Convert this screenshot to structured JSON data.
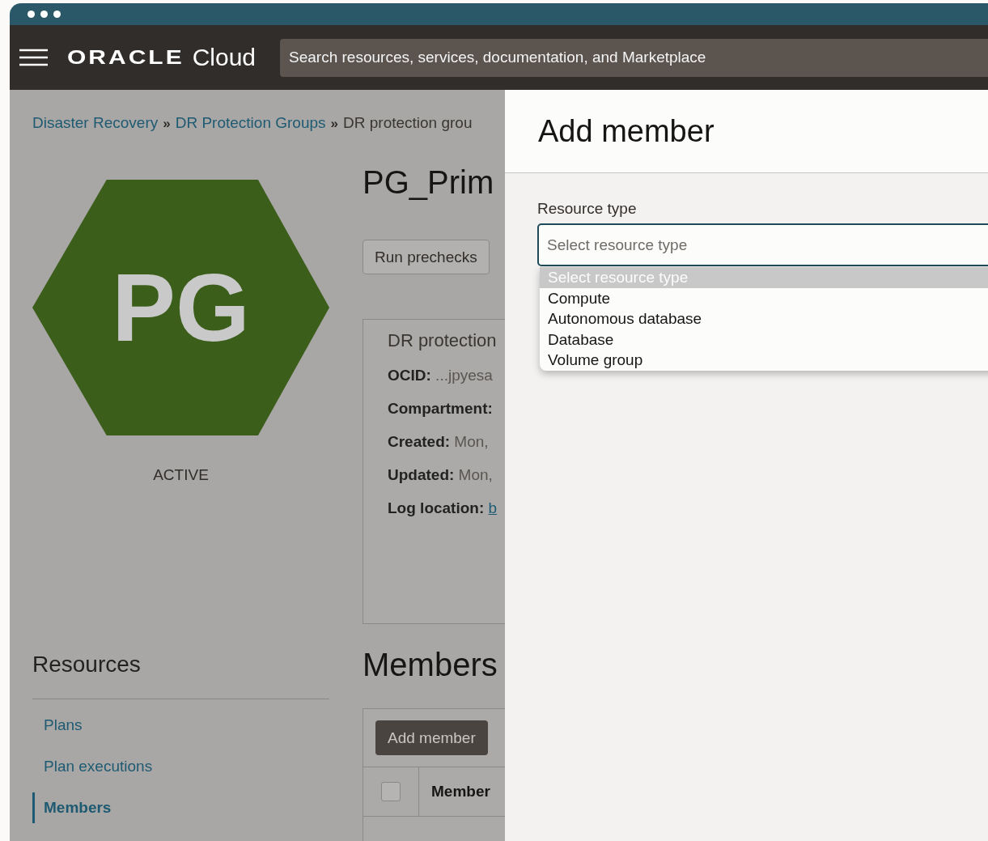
{
  "header": {
    "logo": "ORACLE",
    "product": "Cloud",
    "search": {
      "placeholder": "Search resources, services, documentation, and Marketplace"
    }
  },
  "breadcrumb": [
    {
      "label": "Disaster Recovery",
      "link": true,
      "sep": "»"
    },
    {
      "label": "DR Protection Groups",
      "link": true,
      "sep": "»"
    },
    {
      "label": "DR protection grou",
      "link": false
    }
  ],
  "badge": {
    "initials": "PG",
    "color": "#3b5e1b",
    "status": "ACTIVE"
  },
  "resources": {
    "title": "Resources",
    "items": [
      {
        "label": "Plans",
        "selected": false
      },
      {
        "label": "Plan executions",
        "selected": false
      },
      {
        "label": "Members",
        "selected": true
      }
    ]
  },
  "detail": {
    "title": "PG_Prim",
    "actions": [
      "Run prechecks"
    ],
    "info_card": {
      "title": "DR protection",
      "fields": [
        {
          "label": "OCID:",
          "value": "...jpyesa",
          "kind": "text"
        },
        {
          "label": "Compartment:"
        },
        {
          "label": "Created:",
          "value": "Mon,",
          "kind": "text"
        },
        {
          "label": "Updated:",
          "value": "Mon,",
          "kind": "text"
        },
        {
          "label": "Log location:",
          "value": "b",
          "kind": "link"
        }
      ]
    }
  },
  "members": {
    "title": "Members",
    "button": "Add member",
    "select_all": {
      "checked": false
    },
    "columns": [
      "Member"
    ]
  },
  "drawer": {
    "title": "Add member",
    "field": {
      "label": "Resource type",
      "placeholder": "Select resource type",
      "options": [
        {
          "label": "Select resource type",
          "selected": true
        },
        {
          "label": "Compute",
          "selected": false
        },
        {
          "label": "Autonomous database",
          "selected": false
        },
        {
          "label": "Database",
          "selected": false
        },
        {
          "label": "Volume group",
          "selected": false
        }
      ]
    }
  }
}
